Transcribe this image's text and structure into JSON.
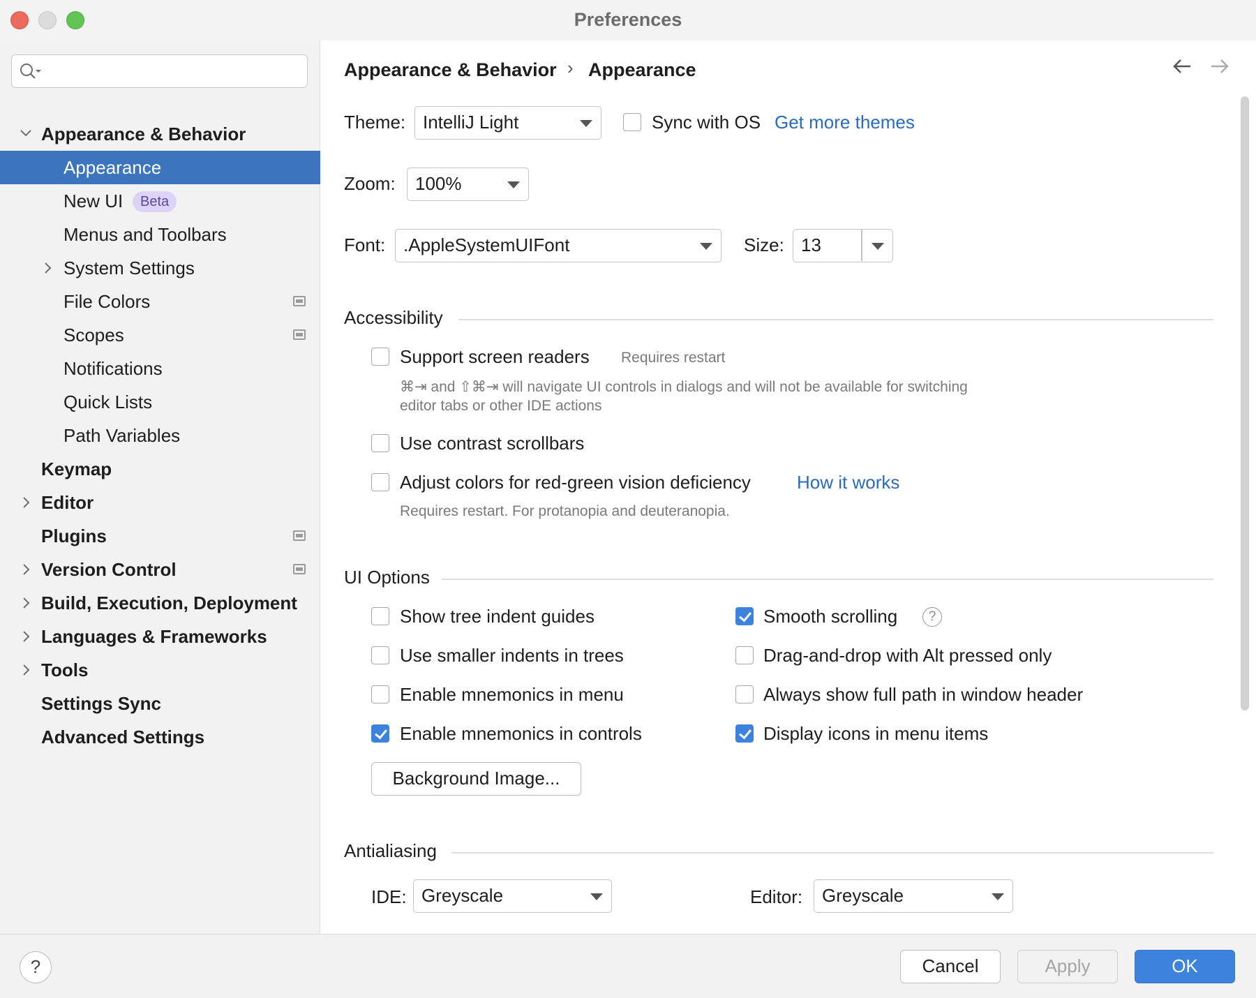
{
  "window": {
    "title": "Preferences"
  },
  "sidebar": {
    "search_placeholder": "",
    "items": [
      {
        "label": "Appearance & Behavior",
        "bold": true,
        "expanded": true
      },
      {
        "label": "Appearance",
        "selected": true
      },
      {
        "label": "New UI",
        "badge": "Beta"
      },
      {
        "label": "Menus and Toolbars"
      },
      {
        "label": "System Settings",
        "collapsed": true
      },
      {
        "label": "File Colors",
        "project_icon": true
      },
      {
        "label": "Scopes",
        "project_icon": true
      },
      {
        "label": "Notifications"
      },
      {
        "label": "Quick Lists"
      },
      {
        "label": "Path Variables"
      },
      {
        "label": "Keymap",
        "bold": true
      },
      {
        "label": "Editor",
        "bold": true,
        "collapsed": true
      },
      {
        "label": "Plugins",
        "bold": true,
        "project_icon": true
      },
      {
        "label": "Version Control",
        "bold": true,
        "collapsed": true,
        "project_icon": true
      },
      {
        "label": "Build, Execution, Deployment",
        "bold": true,
        "collapsed": true
      },
      {
        "label": "Languages & Frameworks",
        "bold": true,
        "collapsed": true
      },
      {
        "label": "Tools",
        "bold": true,
        "collapsed": true
      },
      {
        "label": "Settings Sync",
        "bold": true
      },
      {
        "label": "Advanced Settings",
        "bold": true
      }
    ]
  },
  "header": {
    "breadcrumb_parent": "Appearance & Behavior",
    "breadcrumb_separator": "›",
    "breadcrumb_current": "Appearance",
    "back_icon": "arrow-left-icon",
    "forward_icon": "arrow-right-icon"
  },
  "theme": {
    "label": "Theme:",
    "value": "IntelliJ Light",
    "sync_label": "Sync with OS",
    "sync_checked": false,
    "more_link": "Get more themes"
  },
  "zoom": {
    "label": "Zoom:",
    "value": "100%"
  },
  "font": {
    "label": "Font:",
    "value": ".AppleSystemUIFont",
    "size_label": "Size:",
    "size_value": "13"
  },
  "accessibility": {
    "title": "Accessibility",
    "screen_readers": {
      "label": "Support screen readers",
      "checked": false,
      "note": "Requires restart"
    },
    "screen_readers_hint_1": "⌘⇥ and ⇧⌘⇥ will navigate UI controls in dialogs and will not be available for switching",
    "screen_readers_hint_2": "editor tabs or other IDE actions",
    "contrast_scrollbars": {
      "label": "Use contrast scrollbars",
      "checked": false
    },
    "color_deficiency": {
      "label": "Adjust colors for red-green vision deficiency",
      "checked": false,
      "link": "How it works"
    },
    "color_deficiency_hint": "Requires restart. For protanopia and deuteranopia."
  },
  "ui_options": {
    "title": "UI Options",
    "left": [
      {
        "label": "Show tree indent guides",
        "checked": false
      },
      {
        "label": "Use smaller indents in trees",
        "checked": false
      },
      {
        "label": "Enable mnemonics in menu",
        "checked": false
      },
      {
        "label": "Enable mnemonics in controls",
        "checked": true
      }
    ],
    "right": [
      {
        "label": "Smooth scrolling",
        "checked": true,
        "help": "?"
      },
      {
        "label": "Drag-and-drop with Alt pressed only",
        "checked": false
      },
      {
        "label": "Always show full path in window header",
        "checked": false
      },
      {
        "label": "Display icons in menu items",
        "checked": true
      }
    ],
    "background_button": "Background Image..."
  },
  "antialiasing": {
    "title": "Antialiasing",
    "ide_label": "IDE:",
    "ide_value": "Greyscale",
    "editor_label": "Editor:",
    "editor_value": "Greyscale"
  },
  "footer": {
    "help": "?",
    "cancel": "Cancel",
    "apply": "Apply",
    "ok": "OK"
  },
  "colors": {
    "accent": "#3d82dd",
    "selection": "#3d74be",
    "link": "#2a6bbf"
  }
}
